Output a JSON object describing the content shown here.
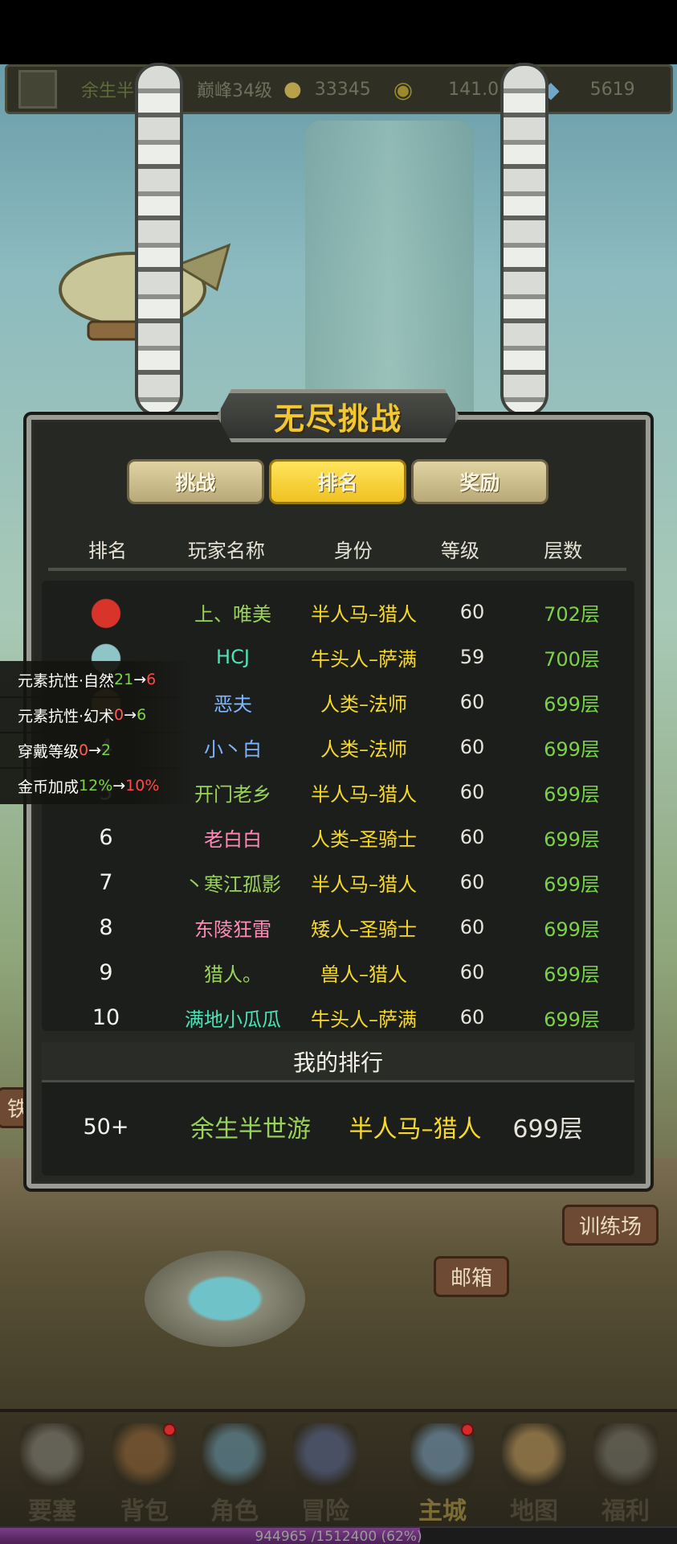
{
  "status_bar": {
    "player_name": "余生半",
    "level": "巅峰34级",
    "power": "33345",
    "gold": "141.0",
    "diamonds": "5619"
  },
  "panel": {
    "title": "无尽挑战",
    "tabs": [
      {
        "label": "挑战",
        "active": false
      },
      {
        "label": "排名",
        "active": true
      },
      {
        "label": "奖励",
        "active": false
      }
    ],
    "columns": [
      "排名",
      "玩家名称",
      "身份",
      "等级",
      "层数"
    ],
    "rows": [
      {
        "rank": "1",
        "name": "上、唯美",
        "role": "半人马–猎人",
        "level": "60",
        "floor": "702层",
        "name_color": "#9ad35a",
        "medal": "crown-icon"
      },
      {
        "rank": "2",
        "name": "HCJ",
        "role": "牛头人–萨满",
        "level": "59",
        "floor": "700层",
        "name_color": "#4de2b8",
        "medal": "silver-crown-icon"
      },
      {
        "rank": "3",
        "name": "恶夫",
        "role": "人类–法师",
        "level": "60",
        "floor": "699层",
        "name_color": "#7fb6ff",
        "medal": "bronze-crown-icon"
      },
      {
        "rank": "4",
        "name": "小丶白",
        "role": "人类–法师",
        "level": "60",
        "floor": "699层",
        "name_color": "#7fb6ff",
        "medal": ""
      },
      {
        "rank": "5",
        "name": "开门老乡",
        "role": "半人马–猎人",
        "level": "60",
        "floor": "699层",
        "name_color": "#9ad35a",
        "medal": ""
      },
      {
        "rank": "6",
        "name": "老白白",
        "role": "人类–圣骑士",
        "level": "60",
        "floor": "699层",
        "name_color": "#ff8ab8",
        "medal": ""
      },
      {
        "rank": "7",
        "name": "丶寒江孤影",
        "role": "半人马–猎人",
        "level": "60",
        "floor": "699层",
        "name_color": "#9ad35a",
        "medal": ""
      },
      {
        "rank": "8",
        "name": "东陵狂雷",
        "role": "矮人–圣骑士",
        "level": "60",
        "floor": "699层",
        "name_color": "#ff8ab8",
        "medal": ""
      },
      {
        "rank": "9",
        "name": "猎人。",
        "role": "兽人–猎人",
        "level": "60",
        "floor": "699层",
        "name_color": "#9ad35a",
        "medal": ""
      },
      {
        "rank": "10",
        "name": "满地小瓜瓜",
        "role": "牛头人–萨满",
        "level": "60",
        "floor": "699层",
        "name_color": "#4de2b8",
        "medal": ""
      }
    ],
    "my_rank": {
      "title": "我的排行",
      "rank": "50+",
      "name": "余生半世游",
      "role": "半人马–猎人",
      "floor": "699层"
    }
  },
  "attribute_changes": [
    {
      "label": "元素抗性·自然 ",
      "from": "21",
      "arrow": "→",
      "to": "6",
      "from_color": "green",
      "to_color": "red"
    },
    {
      "label": "元素抗性·幻术 ",
      "from": "0",
      "arrow": "→",
      "to": "6",
      "from_color": "red",
      "to_color": "green"
    },
    {
      "label": "穿戴等级 ",
      "from": "0",
      "arrow": "→",
      "to": "2",
      "from_color": "red",
      "to_color": "green"
    },
    {
      "label": "金币加成 ",
      "from": "12%",
      "arrow": "→",
      "to": "10%",
      "from_color": "green",
      "to_color": "red"
    }
  ],
  "scene_signs": {
    "training": "训练场",
    "mailbox": "邮箱",
    "left_edge": "铁"
  },
  "bottom_nav": [
    {
      "label": "要塞",
      "icon": "fortress-icon",
      "badge": false,
      "active": false
    },
    {
      "label": "背包",
      "icon": "backpack-icon",
      "badge": true,
      "active": false
    },
    {
      "label": "角色",
      "icon": "helmet-icon",
      "badge": false,
      "active": false
    },
    {
      "label": "冒险",
      "icon": "portal-icon",
      "badge": false,
      "active": false
    },
    {
      "label": "主城",
      "icon": "castle-icon",
      "badge": true,
      "active": true
    },
    {
      "label": "地图",
      "icon": "scroll-map-icon",
      "badge": false,
      "active": false
    },
    {
      "label": "福利",
      "icon": "gift-icon",
      "badge": false,
      "active": false
    }
  ],
  "xp": {
    "text": "944965 /1512400 (62%)",
    "fraction": 0.62
  },
  "colors": {
    "gold_title": "#f1c732",
    "role_yellow": "#f6d92a",
    "floor_green": "#7cd34a",
    "my_name_green": "#9ad35a"
  }
}
